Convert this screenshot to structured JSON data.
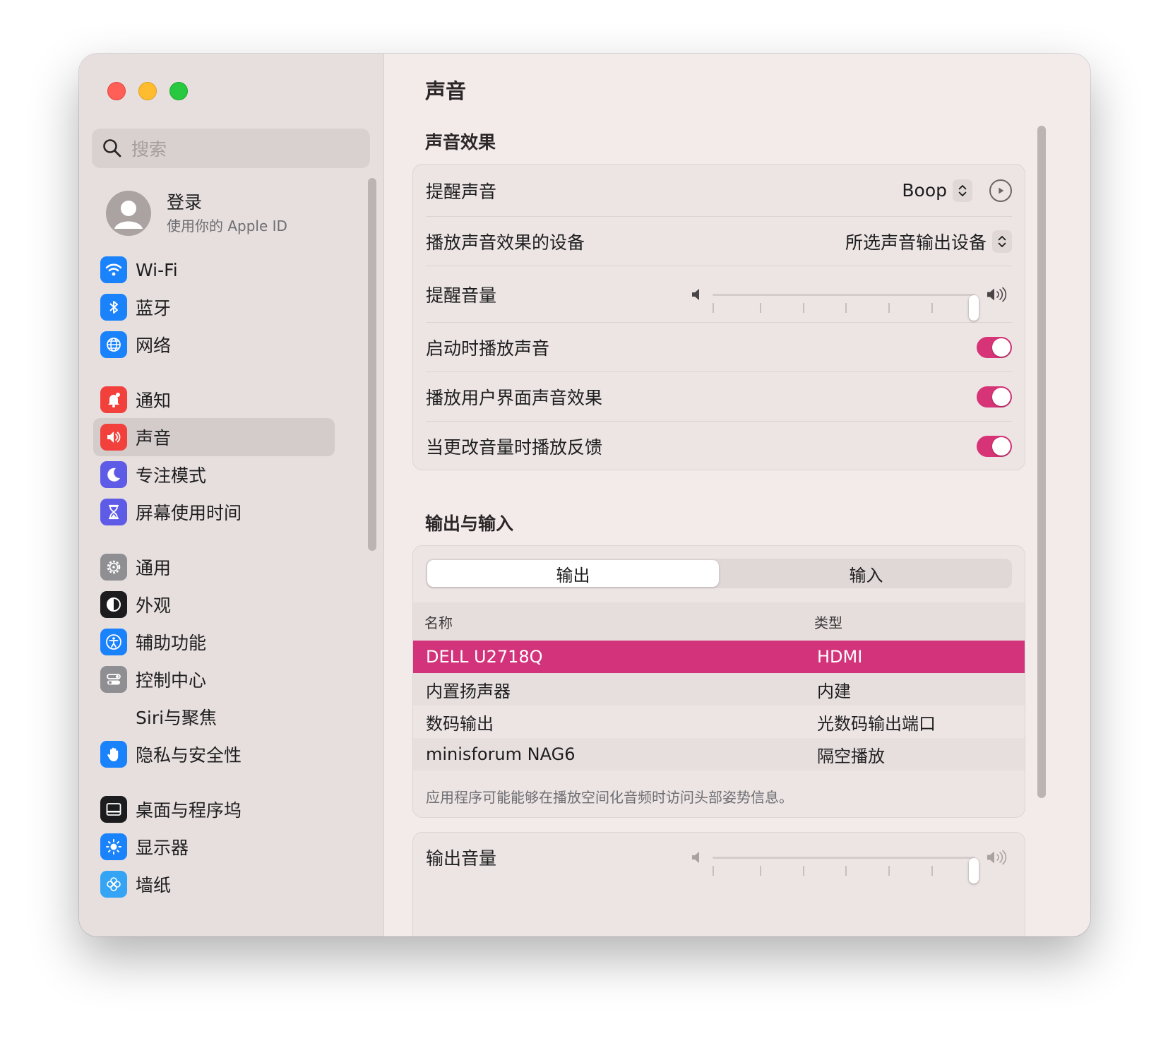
{
  "window": {
    "page_title": "声音"
  },
  "sidebar": {
    "search_placeholder": "搜索",
    "account": {
      "name": "登录",
      "subtitle": "使用你的 Apple ID"
    },
    "items": [
      {
        "label": "Wi-Fi",
        "icon": "wifi-icon",
        "color": "#1a82fb"
      },
      {
        "label": "蓝牙",
        "icon": "bluetooth-icon",
        "color": "#1a82fb"
      },
      {
        "label": "网络",
        "icon": "globe-icon",
        "color": "#1a82fb"
      },
      {
        "label": "通知",
        "icon": "bell-icon",
        "color": "#f2413c"
      },
      {
        "label": "声音",
        "icon": "speaker-icon",
        "color": "#f2413c",
        "active": true
      },
      {
        "label": "专注模式",
        "icon": "moon-icon",
        "color": "#5e5ce6"
      },
      {
        "label": "屏幕使用时间",
        "icon": "hourglass-icon",
        "color": "#5e5ce6"
      },
      {
        "label": "通用",
        "icon": "gear-icon",
        "color": "#8e8e93"
      },
      {
        "label": "外观",
        "icon": "appearance-icon",
        "color": "#1c1c1e"
      },
      {
        "label": "辅助功能",
        "icon": "accessibility-icon",
        "color": "#1a82fb"
      },
      {
        "label": "控制中心",
        "icon": "control-center-icon",
        "color": "#8e8e93"
      },
      {
        "label": "Siri与聚焦",
        "icon": "siri-icon",
        "color": "#e7dfde"
      },
      {
        "label": "隐私与安全性",
        "icon": "hand-icon",
        "color": "#1a82fb"
      },
      {
        "label": "桌面与程序坞",
        "icon": "dock-icon",
        "color": "#1c1c1e"
      },
      {
        "label": "显示器",
        "icon": "sun-icon",
        "color": "#1a82fb"
      },
      {
        "label": "墙纸",
        "icon": "flower-icon",
        "color": "#35a4f5"
      }
    ]
  },
  "sound_effects": {
    "section_title": "声音效果",
    "alert_sound": {
      "label": "提醒声音",
      "value": "Boop"
    },
    "play_device": {
      "label": "播放声音效果的设备",
      "value": "所选声音输出设备"
    },
    "alert_volume": {
      "label": "提醒音量",
      "level": 1.0
    },
    "startup_sound": {
      "label": "启动时播放声音",
      "on": true
    },
    "ui_sounds": {
      "label": "播放用户界面声音效果",
      "on": true
    },
    "volume_feedback": {
      "label": "当更改音量时播放反馈",
      "on": true
    }
  },
  "output_input": {
    "section_title": "输出与输入",
    "tabs": [
      {
        "label": "输出",
        "selected": true
      },
      {
        "label": "输入",
        "selected": false
      }
    ],
    "columns": [
      "名称",
      "类型"
    ],
    "rows": [
      {
        "name": "DELL U2718Q",
        "type": "HDMI",
        "selected": true
      },
      {
        "name": "内置扬声器",
        "type": "内建"
      },
      {
        "name": "数码输出",
        "type": "光数码输出端口"
      },
      {
        "name": "minisforum NAG6",
        "type": "隔空播放"
      }
    ],
    "note": "应用程序可能能够在播放空间化音频时访问头部姿势信息。"
  },
  "output_volume": {
    "label": "输出音量",
    "level": 1.0
  },
  "colors": {
    "accent": "#d3337b",
    "toggle_on": "#d63476"
  }
}
